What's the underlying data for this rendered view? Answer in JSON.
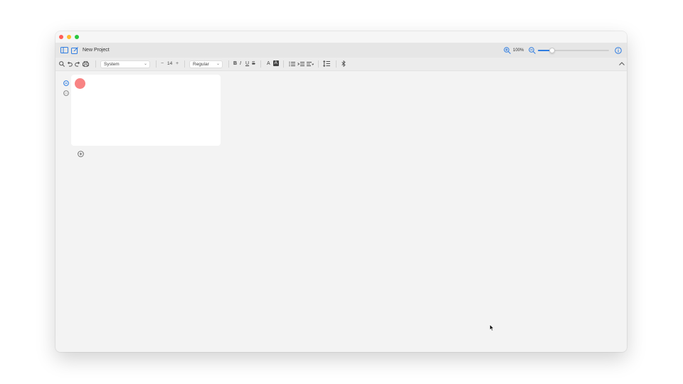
{
  "window": {
    "traffic_lights": {
      "close": "#ff5f57",
      "minimize": "#febc2e",
      "zoom": "#28c840"
    }
  },
  "header": {
    "title": "New Project",
    "zoom_label": "100%",
    "zoom_level": 0.2
  },
  "format": {
    "font_family": "System",
    "font_size": "14",
    "font_weight": "Regular",
    "bold": "B",
    "italic": "I",
    "underline": "U",
    "strike": "S",
    "text_color": "A",
    "highlight": "A",
    "decrease": "−",
    "increase": "+"
  },
  "card": {
    "dot_color": "#f88383"
  },
  "colors": {
    "accent": "#2f7de1",
    "window_bg": "#f3f3f3"
  },
  "icons": {
    "sidebar": "sidebar-icon",
    "compose": "compose-icon",
    "zoom_in": "zoom-in-icon",
    "zoom_out": "zoom-out-icon",
    "info": "info-icon",
    "search": "search-icon",
    "undo": "undo-icon",
    "redo": "redo-icon",
    "print": "print-icon",
    "list": "bullet-list-icon",
    "indent": "indent-icon",
    "align": "align-icon",
    "line_spacing": "line-spacing-icon",
    "bluetooth": "bluetooth-icon",
    "collapse": "chevron-up-icon",
    "remove": "remove-circle-icon",
    "more": "more-circle-icon",
    "add": "add-circle-icon"
  }
}
